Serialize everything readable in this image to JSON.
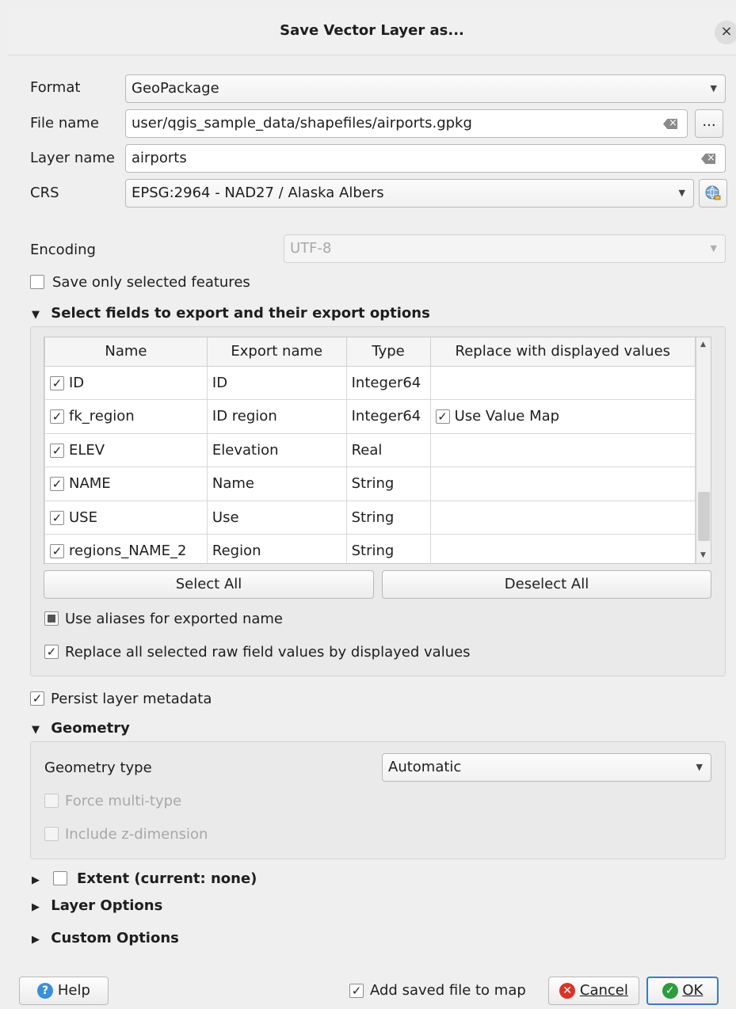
{
  "window": {
    "title": "Save Vector Layer as...",
    "close_glyph": "×"
  },
  "form": {
    "format_label": "Format",
    "format_value": "GeoPackage",
    "filename_label": "File name",
    "filename_value": "user/qgis_sample_data/shapefiles/airports.gpkg",
    "browse_label": "...",
    "layername_label": "Layer name",
    "layername_value": "airports",
    "crs_label": "CRS",
    "crs_value": "EPSG:2964 - NAD27 / Alaska Albers",
    "encoding_label": "Encoding",
    "encoding_value": "UTF-8",
    "save_selected_label": "Save only selected features"
  },
  "fields_section": {
    "title": "Select fields to export and their export options",
    "columns": [
      "Name",
      "Export name",
      "Type",
      "Replace with displayed values"
    ],
    "rows": [
      {
        "name": "ID",
        "export": "ID",
        "type": "Integer64",
        "replace": ""
      },
      {
        "name": "fk_region",
        "export": "ID region",
        "type": "Integer64",
        "replace": "Use Value Map"
      },
      {
        "name": "ELEV",
        "export": "Elevation",
        "type": "Real",
        "replace": ""
      },
      {
        "name": "NAME",
        "export": "Name",
        "type": "String",
        "replace": ""
      },
      {
        "name": "USE",
        "export": "Use",
        "type": "String",
        "replace": ""
      },
      {
        "name": "regions_NAME_2",
        "export": "Region",
        "type": "String",
        "replace": ""
      }
    ],
    "select_all": "Select All",
    "deselect_all": "Deselect All",
    "use_aliases": "Use aliases for exported name",
    "replace_all": "Replace all selected raw field values by displayed values"
  },
  "persist_metadata": "Persist layer metadata",
  "geometry": {
    "title": "Geometry",
    "type_label": "Geometry type",
    "type_value": "Automatic",
    "force_multi": "Force multi-type",
    "include_z": "Include z-dimension"
  },
  "extent_title": "Extent (current: none)",
  "layer_options_title": "Layer Options",
  "custom_options_title": "Custom Options",
  "footer": {
    "help": "Help",
    "add_to_map": "Add saved file to map",
    "cancel": "Cancel",
    "ok": "OK"
  },
  "colors": {
    "help_icon": "#3a8fd8",
    "cancel_icon": "#d9342b",
    "ok_icon": "#2e9b3f",
    "ok_border": "#3d7ac4"
  },
  "check_glyph": "✓",
  "icons": {
    "expanded": "▼",
    "collapsed": "▶",
    "dropdown": "▼"
  }
}
